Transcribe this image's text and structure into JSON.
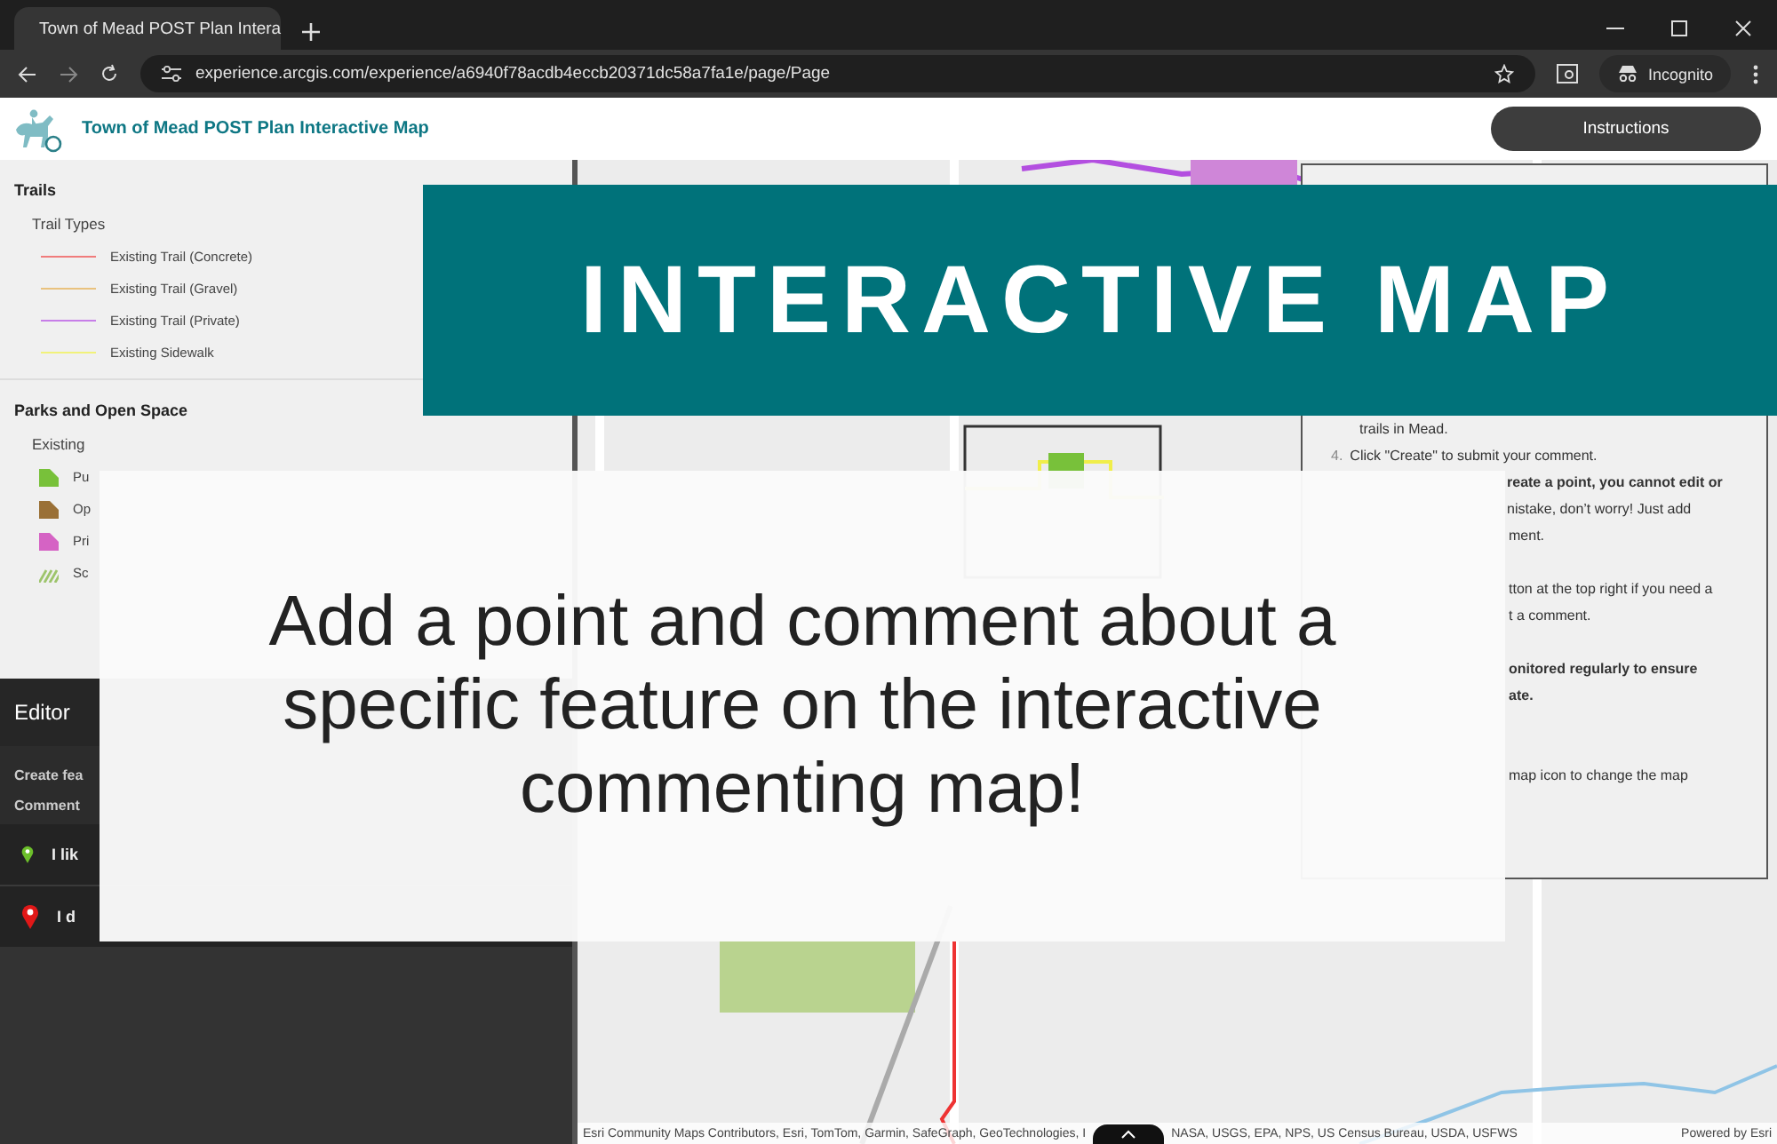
{
  "browser": {
    "tab_title": "Town of Mead POST Plan Intera",
    "url": "experience.arcgis.com/experience/a6940f78acdb4eccb20371dc58a7fa1e/page/Page",
    "profile": "Incognito"
  },
  "app": {
    "title": "Town of Mead POST Plan Interactive Map",
    "instructions_button": "Instructions"
  },
  "legend": {
    "sections": [
      {
        "title": "Trails",
        "group": "Trail Types",
        "items": [
          {
            "label": "Existing Trail (Concrete)",
            "kind": "line",
            "color": "#f07c7c"
          },
          {
            "label": "Existing Trail (Gravel)",
            "kind": "line",
            "color": "#e9c27e"
          },
          {
            "label": "Existing Trail (Private)",
            "kind": "line",
            "color": "#c77ee8"
          },
          {
            "label": "Existing Sidewalk",
            "kind": "line",
            "color": "#f1f27a"
          }
        ]
      },
      {
        "title": "Parks and Open Space",
        "group": "Existing",
        "items": [
          {
            "label": "Pu",
            "kind": "fill",
            "color": "#78c13a"
          },
          {
            "label": "Op",
            "kind": "fill",
            "color": "#9a7036"
          },
          {
            "label": "Pri",
            "kind": "fill",
            "color": "#d563c4"
          },
          {
            "label": "Sc",
            "kind": "hatch",
            "color": "#9dc46b"
          }
        ]
      }
    ]
  },
  "editor": {
    "title": "Editor",
    "create_label": "Create fea",
    "comment_label": "Comment",
    "templates": [
      {
        "label": "I lik",
        "color": "#6cbf2a"
      },
      {
        "label": "I d",
        "color": "#e01818"
      }
    ]
  },
  "instructions_popup": {
    "lines": [
      {
        "kind": "continued",
        "text": "trails in Mead.",
        "bold": false
      },
      {
        "kind": "numbered",
        "number": "4.",
        "text": "Click \"Create\" to submit your comment.",
        "bold": false
      },
      {
        "kind": "fragment",
        "text": "reate a point, you cannot edit or",
        "bold": true
      },
      {
        "kind": "fragment",
        "text": "nistake, don’t worry! Just add",
        "bold": false
      },
      {
        "kind": "fragment",
        "text": "ment.",
        "bold": false
      },
      {
        "kind": "gap"
      },
      {
        "kind": "fragment",
        "text": "tton at the top right if you need a",
        "bold": false
      },
      {
        "kind": "fragment",
        "text": "t a comment.",
        "bold": false
      },
      {
        "kind": "gap"
      },
      {
        "kind": "fragment",
        "text": "onitored regularly to ensure",
        "bold": true
      },
      {
        "kind": "fragment",
        "text": "ate.",
        "bold": true
      },
      {
        "kind": "gap"
      },
      {
        "kind": "gap"
      },
      {
        "kind": "fragment",
        "text": "map icon to change the map",
        "bold": false
      }
    ]
  },
  "map": {
    "attribution_start": "Esri Community Maps Contributors, Esri, TomTom, Garmin, SafeGraph, GeoTechnologies, I",
    "attribution_end": "NASA, USGS, EPA, NPS, US Census Bureau, USDA, USFWS",
    "powered_by": "Powered by Esri"
  },
  "banner": {
    "title": "INTERACTIVE MAP"
  },
  "callout": {
    "text": "Add a point and comment about a specific feature on the interactive commenting map!"
  }
}
